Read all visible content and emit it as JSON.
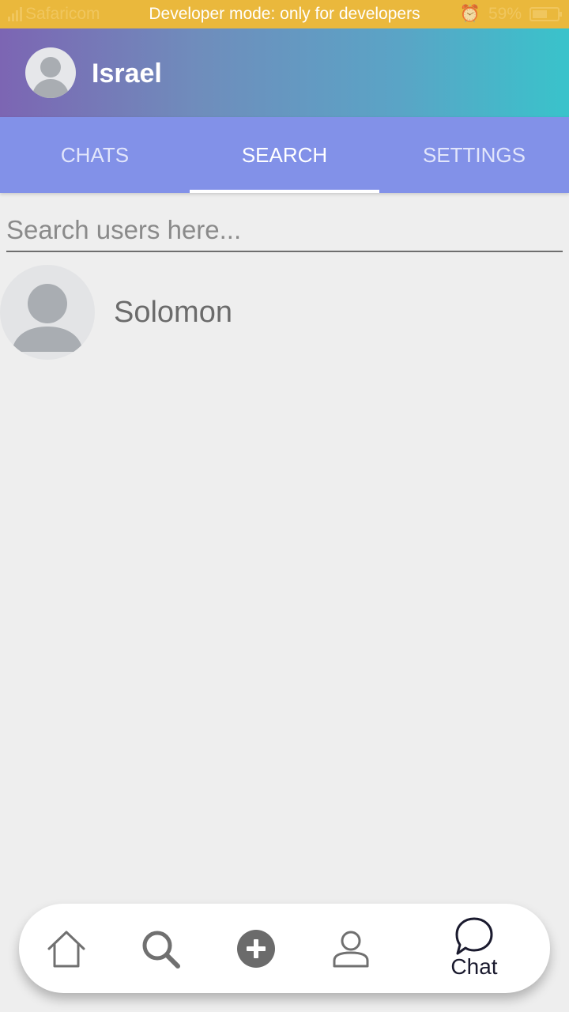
{
  "status_bar": {
    "carrier": "Safaricom",
    "banner": "Developer mode: only for developers",
    "battery": "59%",
    "battery_level": 0.59
  },
  "header": {
    "username": "Israel"
  },
  "tabs": [
    {
      "label": "CHATS",
      "active": false
    },
    {
      "label": "SEARCH",
      "active": true
    },
    {
      "label": "SETTINGS",
      "active": false
    }
  ],
  "search": {
    "placeholder": "Search users here...",
    "value": ""
  },
  "results": [
    {
      "name": "Solomon"
    }
  ],
  "bottom_nav": {
    "items": [
      "home-icon",
      "search-icon",
      "add-icon",
      "profile-icon",
      "chat-icon"
    ],
    "chat_label": "Chat"
  },
  "colors": {
    "status_bar": "#eab83c",
    "header_gradient_start": "#7c65b3",
    "header_gradient_end": "#39c3cb",
    "tab_bar": "#8291e8",
    "background": "#eeeeee"
  }
}
